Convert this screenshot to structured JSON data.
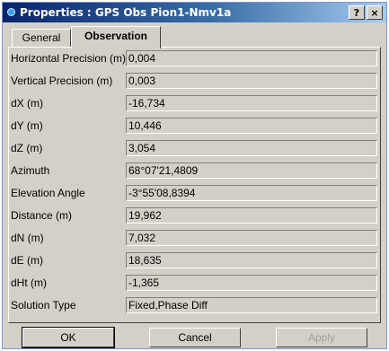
{
  "window": {
    "title": "Properties : GPS Obs Pion1-Nmv1a",
    "help_label": "?",
    "close_label": "×"
  },
  "tabs": [
    "General",
    "Observation"
  ],
  "active_tab": "Observation",
  "fields": [
    {
      "label": "Horizontal Precision (m)",
      "value": "0,004"
    },
    {
      "label": "Vertical Precision (m)",
      "value": "0,003"
    },
    {
      "label": "dX (m)",
      "value": "-16,734"
    },
    {
      "label": "dY (m)",
      "value": "10,446"
    },
    {
      "label": "dZ (m)",
      "value": "3,054"
    },
    {
      "label": "Azimuth",
      "value": "68°07'21,4809"
    },
    {
      "label": "Elevation Angle",
      "value": "-3°55'08,8394"
    },
    {
      "label": "Distance (m)",
      "value": "19,962"
    },
    {
      "label": "dN (m)",
      "value": "7,032"
    },
    {
      "label": "dE (m)",
      "value": "18,635"
    },
    {
      "label": "dHt (m)",
      "value": "-1,365"
    },
    {
      "label": "Solution Type",
      "value": "Fixed,Phase Diff"
    }
  ],
  "buttons": {
    "ok": "OK",
    "cancel": "Cancel",
    "apply": "Apply"
  }
}
